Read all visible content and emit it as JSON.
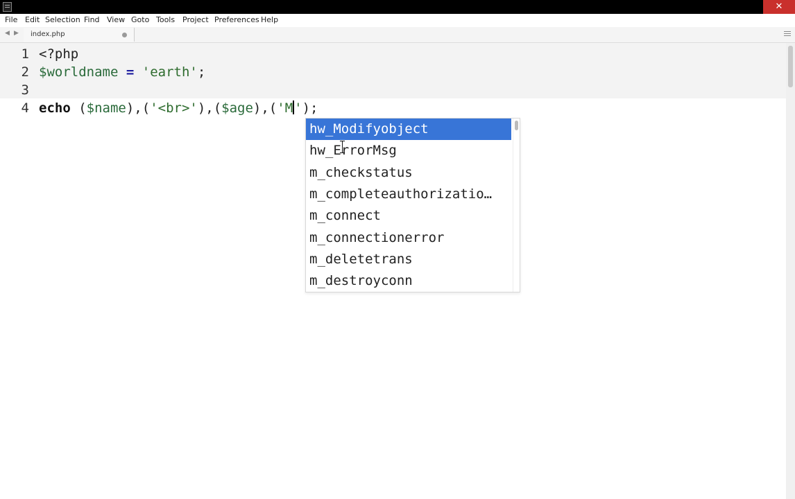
{
  "window": {
    "close_label": "✕"
  },
  "menu": {
    "items": [
      "File",
      "Edit",
      "Selection",
      "Find",
      "View",
      "Goto",
      "Tools",
      "Project",
      "Preferences",
      "Help"
    ]
  },
  "tabs": {
    "nav_left": "◀",
    "nav_right": "▶",
    "active_tab": "index.php"
  },
  "editor": {
    "lines": [
      {
        "number": "1",
        "tokens": [
          {
            "t": "<?php",
            "c": ""
          }
        ]
      },
      {
        "number": "2",
        "tokens": [
          {
            "t": "$worldname",
            "c": "var"
          },
          {
            "t": " ",
            "c": ""
          },
          {
            "t": "=",
            "c": "op"
          },
          {
            "t": " ",
            "c": ""
          },
          {
            "t": "'earth'",
            "c": "str"
          },
          {
            "t": ";",
            "c": ""
          }
        ]
      },
      {
        "number": "3",
        "tokens": []
      },
      {
        "number": "4",
        "tokens": [
          {
            "t": "echo",
            "c": "kw"
          },
          {
            "t": " (",
            "c": ""
          },
          {
            "t": "$name",
            "c": "var"
          },
          {
            "t": "),(",
            "c": ""
          },
          {
            "t": "'<br>'",
            "c": "str"
          },
          {
            "t": "),(",
            "c": ""
          },
          {
            "t": "$age",
            "c": "var"
          },
          {
            "t": "),(",
            "c": ""
          },
          {
            "t": "'M",
            "c": "str"
          },
          {
            "t": "|",
            "c": "cursor"
          },
          {
            "t": "'",
            "c": "str"
          },
          {
            "t": ");",
            "c": ""
          }
        ]
      }
    ]
  },
  "autocomplete": {
    "selected_index": 0,
    "items": [
      "hw_Modifyobject",
      "hw_ErrorMsg",
      "m_checkstatus",
      "m_completeauthorizatio…",
      "m_connect",
      "m_connectionerror",
      "m_deletetrans",
      "m_destroyconn"
    ]
  }
}
